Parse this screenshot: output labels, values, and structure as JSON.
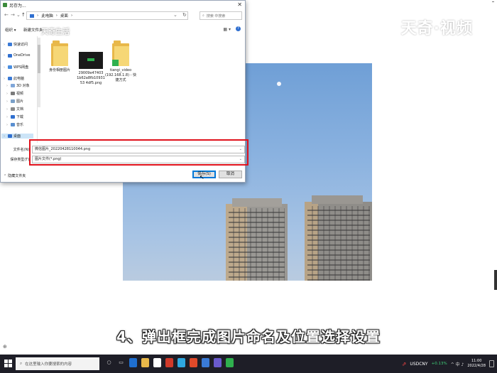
{
  "dialog": {
    "title": "另存为...",
    "close_glyph": "✕",
    "breadcrumb": [
      "此电脑",
      "桌面"
    ],
    "search_placeholder": "搜索 中搜索",
    "toolbar": {
      "organize": "组织 ▾",
      "new_folder": "新建文件夹",
      "view_glyph": "▦ ▾",
      "help_glyph": "?"
    },
    "nav_items": [
      {
        "label": "快速访问",
        "icon": "star-icon",
        "color": "#3a7ad6"
      },
      {
        "label": "OneDrive",
        "icon": "cloud-icon",
        "color": "#2f6fd0"
      },
      {
        "label": "WPS网盘",
        "icon": "cloud-icon",
        "color": "#4a8ee0"
      },
      {
        "label": "此电脑",
        "icon": "computer-icon",
        "color": "#3a7ad6"
      },
      {
        "label": "3D 对象",
        "icon": "cube-icon",
        "color": "#7fa6d9"
      },
      {
        "label": "视频",
        "icon": "video-icon",
        "color": "#7a7a7a"
      },
      {
        "label": "图片",
        "icon": "picture-icon",
        "color": "#7aa0c8"
      },
      {
        "label": "文档",
        "icon": "document-icon",
        "color": "#8a8a8a"
      },
      {
        "label": "下载",
        "icon": "download-icon",
        "color": "#2f6fd0"
      },
      {
        "label": "音乐",
        "icon": "music-icon",
        "color": "#5a8fd0"
      },
      {
        "label": "桌面",
        "icon": "desktop-icon",
        "color": "#2f6fd0"
      }
    ],
    "files": [
      {
        "name": "身份相册图片",
        "kind": "folder"
      },
      {
        "name": "29009e47403 1b62a8fb10931 53 4df5.png",
        "kind": "image"
      },
      {
        "name": "tiangi_video (192.168.1.8) - 快捷方式",
        "kind": "shortcut"
      }
    ],
    "filename_label": "文件名(N):",
    "filename_value": "微信图片_20220428110044.png",
    "filetype_label": "保存类型(T):",
    "filetype_value": "图片文件(*.png)",
    "hide_folders": "隐藏文件夹",
    "save_button": "保存(S)",
    "cancel_button": "取消"
  },
  "watermark": "天奇·视频",
  "watermark_small": "天奇生活",
  "subtitle": "4、弹出框完成图片命名及位置选择设置",
  "taskbar": {
    "search_placeholder": "在这里输入你要搜索的内容",
    "stock_symbol": "USDCNY",
    "stock_change": "+0.13%",
    "system_tray": "^ 中 ♪",
    "time": "11:00",
    "date": "2022/4/28"
  },
  "colors": {
    "highlight": "#e0121c",
    "selection": "#cce4f7",
    "taskbar": "#1e1e27"
  }
}
